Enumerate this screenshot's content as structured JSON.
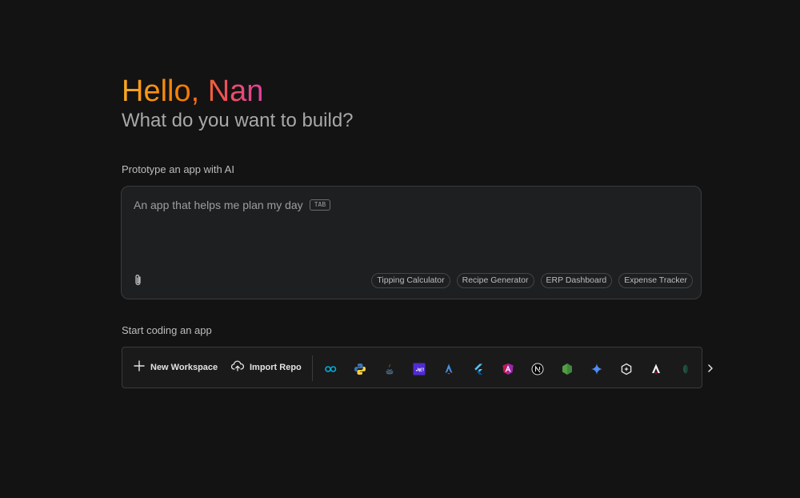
{
  "greeting": "Hello, Nan",
  "subheading": "What do you want to build?",
  "prototype": {
    "label": "Prototype an app with AI",
    "placeholder": "An app that helps me plan my day",
    "tab_hint": "TAB",
    "suggestions": [
      "Tipping Calculator",
      "Recipe Generator",
      "ERP Dashboard",
      "Expense Tracker"
    ]
  },
  "coding": {
    "label": "Start coding an app",
    "new_workspace": "New Workspace",
    "import_repo": "Import Repo",
    "templates": [
      "go-icon",
      "python-icon",
      "java-icon",
      "dotnet-icon",
      "astro-icon",
      "flutter-icon",
      "angular-icon",
      "nextjs-icon",
      "nodejs-icon",
      "gemini-icon",
      "hexagon-icon",
      "analog-icon",
      "emerald-icon"
    ]
  },
  "colors": {
    "background": "#131314",
    "surface": "#1e1f20",
    "border": "#3a3b3d",
    "greeting_gradient_start": "#f9a825",
    "greeting_gradient_end": "#e040a0"
  }
}
